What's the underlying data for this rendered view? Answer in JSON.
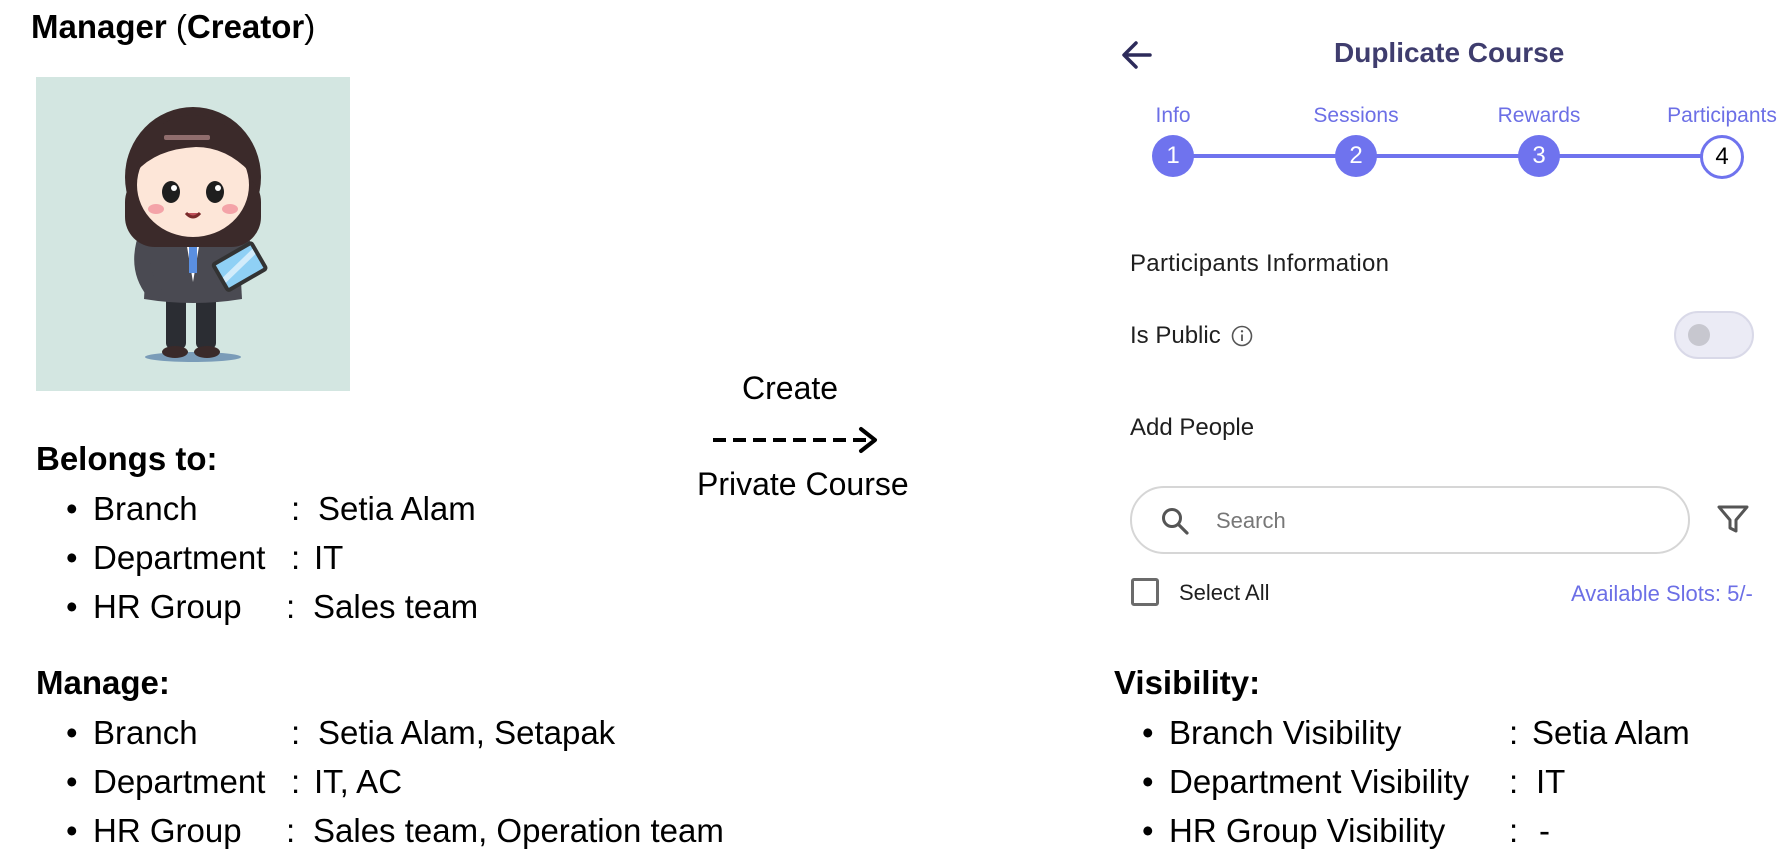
{
  "left": {
    "title_main": "Manager",
    "title_paren_open": "(",
    "title_role": "Creator",
    "title_paren_close": ")",
    "belongs_heading": "Belongs to:",
    "belongs": [
      {
        "key": "Branch",
        "value": "Setia Alam"
      },
      {
        "key": "Department",
        "value": "IT"
      },
      {
        "key": "HR Group",
        "value": "Sales team"
      }
    ],
    "manage_heading": "Manage:",
    "manage": [
      {
        "key": "Branch",
        "value": "Setia Alam, Setapak"
      },
      {
        "key": "Department",
        "value": "IT, AC"
      },
      {
        "key": "HR Group",
        "value": "Sales team, Operation team"
      }
    ]
  },
  "middle": {
    "create_label": "Create",
    "private_label": "Private Course"
  },
  "panel": {
    "title": "Duplicate Course",
    "steps": [
      {
        "label": "Info",
        "number": "1"
      },
      {
        "label": "Sessions",
        "number": "2"
      },
      {
        "label": "Rewards",
        "number": "3"
      },
      {
        "label": "Participants",
        "number": "4"
      }
    ],
    "section_title": "Participants Information",
    "is_public_label": "Is Public",
    "is_public_on": false,
    "add_people_label": "Add People",
    "search_placeholder": "Search",
    "select_all_label": "Select All",
    "available_slots": "Available Slots: 5/-"
  },
  "visibility": {
    "heading": "Visibility:",
    "items": [
      {
        "key": "Branch Visibility",
        "value": "Setia Alam"
      },
      {
        "key": "Department Visibility",
        "value": "IT"
      },
      {
        "key": "HR Group Visibility",
        "value": "-"
      }
    ]
  },
  "colors": {
    "accent": "#6f73ee",
    "title_text": "#3f3d6e",
    "avatar_bg": "#d3e6e1"
  }
}
